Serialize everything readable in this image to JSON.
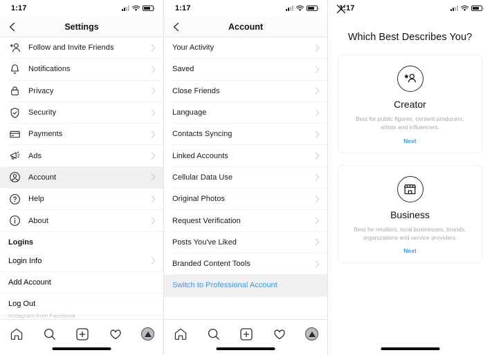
{
  "status_bar": {
    "time": "1:17",
    "signal_icon": "signal-bars-icon",
    "wifi_icon": "wifi-icon",
    "battery_icon": "battery-icon"
  },
  "panel_settings": {
    "nav": {
      "back_icon": "chevron-left-icon",
      "title": "Settings"
    },
    "items": [
      {
        "label": "Follow and Invite Friends",
        "icon": "person-plus-icon",
        "selected": false
      },
      {
        "label": "Notifications",
        "icon": "bell-icon",
        "selected": false
      },
      {
        "label": "Privacy",
        "icon": "lock-icon",
        "selected": false
      },
      {
        "label": "Security",
        "icon": "shield-check-icon",
        "selected": false
      },
      {
        "label": "Payments",
        "icon": "credit-card-icon",
        "selected": false
      },
      {
        "label": "Ads",
        "icon": "megaphone-icon",
        "selected": false
      },
      {
        "label": "Account",
        "icon": "account-circle-icon",
        "selected": true
      },
      {
        "label": "Help",
        "icon": "question-circle-icon",
        "selected": false
      },
      {
        "label": "About",
        "icon": "info-circle-icon",
        "selected": false
      }
    ],
    "logins_header": "Logins",
    "login_info": "Login Info",
    "add_account": "Add Account",
    "log_out": "Log Out",
    "footer": "Instagram from Facebook"
  },
  "panel_account": {
    "nav": {
      "back_icon": "chevron-left-icon",
      "title": "Account"
    },
    "items": [
      {
        "label": "Your Activity",
        "chevron": true,
        "highlight": false
      },
      {
        "label": "Saved",
        "chevron": true,
        "highlight": false
      },
      {
        "label": "Close Friends",
        "chevron": true,
        "highlight": false
      },
      {
        "label": "Language",
        "chevron": true,
        "highlight": false
      },
      {
        "label": "Contacts Syncing",
        "chevron": true,
        "highlight": false
      },
      {
        "label": "Linked Accounts",
        "chevron": true,
        "highlight": false
      },
      {
        "label": "Cellular Data Use",
        "chevron": true,
        "highlight": false
      },
      {
        "label": "Original Photos",
        "chevron": true,
        "highlight": false
      },
      {
        "label": "Request Verification",
        "chevron": true,
        "highlight": false
      },
      {
        "label": "Posts You've Liked",
        "chevron": true,
        "highlight": false
      },
      {
        "label": "Branded Content Tools",
        "chevron": true,
        "highlight": false
      },
      {
        "label": "Switch to Professional Account",
        "chevron": false,
        "highlight": true
      }
    ]
  },
  "panel_choose": {
    "close_icon": "close-x-icon",
    "title": "Which Best Describes You?",
    "cards": [
      {
        "icon": "creator-person-star-icon",
        "title": "Creator",
        "description": "Best for public figures, content producers, artists and influencers.",
        "next_label": "Next"
      },
      {
        "icon": "storefront-icon",
        "title": "Business",
        "description": "Best for retailers, local businesses, brands, organizations and service providers.",
        "next_label": "Next"
      }
    ]
  },
  "tab_bar": {
    "tabs": [
      {
        "icon": "home-icon",
        "name": "home"
      },
      {
        "icon": "search-icon",
        "name": "search"
      },
      {
        "icon": "plus-box-icon",
        "name": "new-post"
      },
      {
        "icon": "heart-icon",
        "name": "activity"
      },
      {
        "icon": "profile-avatar-icon",
        "name": "profile"
      }
    ]
  },
  "colors": {
    "accent_blue": "#3797f0",
    "selected_row": "#f0f0f0",
    "text": "#171717",
    "muted": "#a9a9a9"
  }
}
